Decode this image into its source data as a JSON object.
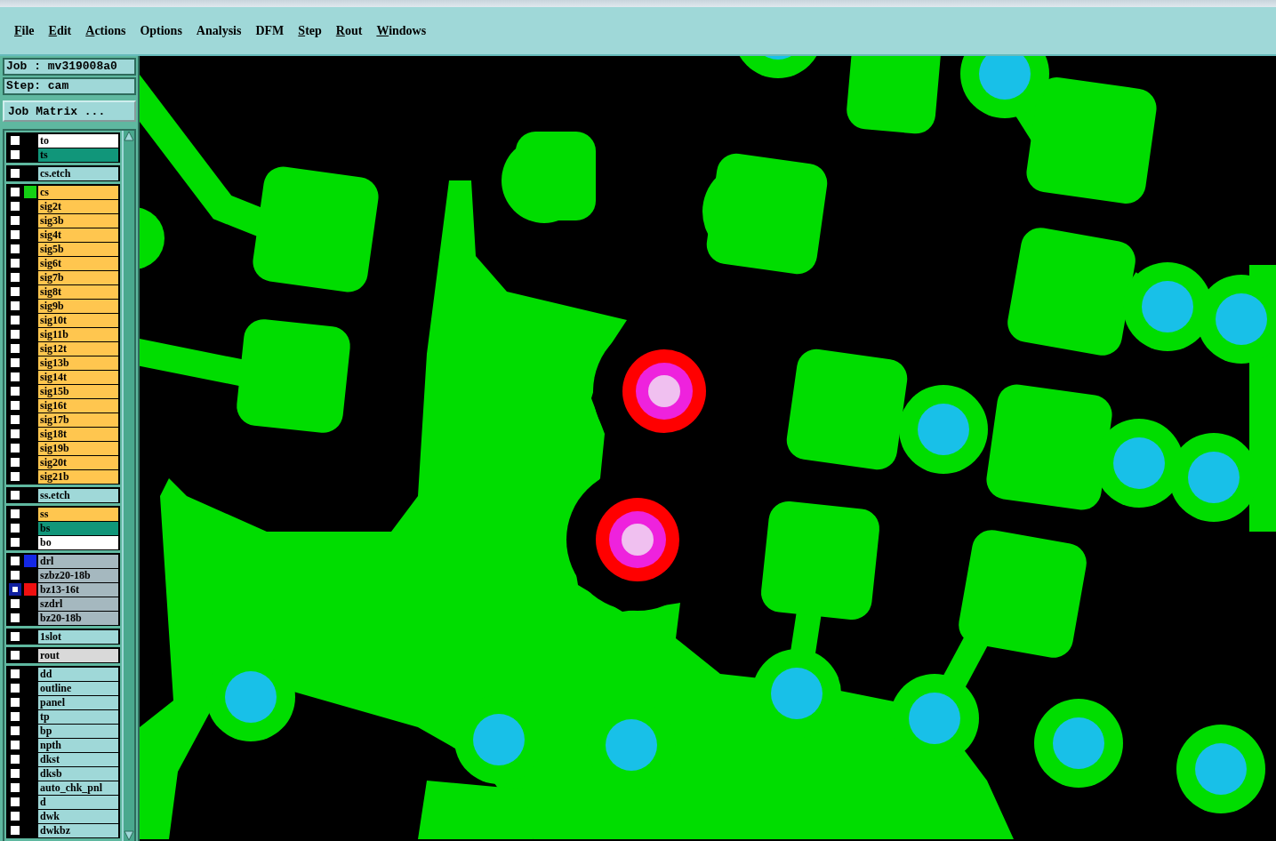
{
  "menu": [
    {
      "label": "File",
      "mnemonic": true
    },
    {
      "label": "Edit",
      "mnemonic": true
    },
    {
      "label": "Actions",
      "mnemonic": true
    },
    {
      "label": "Options",
      "mnemonic": false
    },
    {
      "label": "Analysis",
      "mnemonic": false
    },
    {
      "label": "DFM",
      "mnemonic": false
    },
    {
      "label": "Step",
      "mnemonic": true
    },
    {
      "label": "Rout",
      "mnemonic": true
    },
    {
      "label": "Windows",
      "mnemonic": true
    }
  ],
  "job": "Job : mv319008a0",
  "step": "Step: cam",
  "matrix_button": "Job Matrix ...",
  "layer_groups": [
    {
      "layers": [
        {
          "name": "to",
          "color": "#ffffff",
          "selected": false
        },
        {
          "name": "ts",
          "color": "#11967a",
          "selected": false
        }
      ]
    },
    {
      "layers": [
        {
          "name": "cs.etch",
          "color": "#9fd8d8",
          "selected": false
        }
      ]
    },
    {
      "layers": [
        {
          "name": "cs",
          "color": "#ffc64f",
          "swatch": {
            "color": "#14d014"
          },
          "selected": false
        },
        {
          "name": "sig2t",
          "color": "#ffc64f",
          "selected": false
        },
        {
          "name": "sig3b",
          "color": "#ffc64f",
          "selected": false
        },
        {
          "name": "sig4t",
          "color": "#ffc64f",
          "selected": false
        },
        {
          "name": "sig5b",
          "color": "#ffc64f",
          "selected": false
        },
        {
          "name": "sig6t",
          "color": "#ffc64f",
          "selected": false
        },
        {
          "name": "sig7b",
          "color": "#ffc64f",
          "selected": false
        },
        {
          "name": "sig8t",
          "color": "#ffc64f",
          "selected": false
        },
        {
          "name": "sig9b",
          "color": "#ffc64f",
          "selected": false
        },
        {
          "name": "sig10t",
          "color": "#ffc64f",
          "selected": false
        },
        {
          "name": "sig11b",
          "color": "#ffc64f",
          "selected": false
        },
        {
          "name": "sig12t",
          "color": "#ffc64f",
          "selected": false
        },
        {
          "name": "sig13b",
          "color": "#ffc64f",
          "selected": false
        },
        {
          "name": "sig14t",
          "color": "#ffc64f",
          "selected": false
        },
        {
          "name": "sig15b",
          "color": "#ffc64f",
          "selected": false
        },
        {
          "name": "sig16t",
          "color": "#ffc64f",
          "selected": false
        },
        {
          "name": "sig17b",
          "color": "#ffc64f",
          "selected": false
        },
        {
          "name": "sig18t",
          "color": "#ffc64f",
          "selected": false
        },
        {
          "name": "sig19b",
          "color": "#ffc64f",
          "selected": false
        },
        {
          "name": "sig20t",
          "color": "#ffc64f",
          "selected": false
        },
        {
          "name": "sig21b",
          "color": "#ffc64f",
          "selected": false
        }
      ]
    },
    {
      "layers": [
        {
          "name": "ss.etch",
          "color": "#9fd8d8",
          "selected": false
        }
      ]
    },
    {
      "layers": [
        {
          "name": "ss",
          "color": "#ffc64f",
          "selected": false
        },
        {
          "name": "bs",
          "color": "#11967a",
          "selected": false
        },
        {
          "name": "bo",
          "color": "#ffffff",
          "selected": false
        }
      ]
    },
    {
      "layers": [
        {
          "name": "drl",
          "color": "#a5b8bf",
          "swatch": {
            "color": "#1428e6"
          },
          "selected": false
        },
        {
          "name": "szbz20-18b",
          "color": "#a5b8bf",
          "selected": false
        },
        {
          "name": "bz13-16t",
          "color": "#a5b8bf",
          "swatch": {
            "color": "#f01010"
          },
          "selected": true
        },
        {
          "name": "szdrl",
          "color": "#a5b8bf",
          "selected": false
        },
        {
          "name": "bz20-18b",
          "color": "#a5b8bf",
          "selected": false
        }
      ]
    },
    {
      "layers": [
        {
          "name": "1slot",
          "color": "#9fd8d8",
          "selected": false
        }
      ]
    },
    {
      "layers": [
        {
          "name": "rout",
          "color": "#d9d9d9",
          "selected": false
        }
      ]
    },
    {
      "layers": [
        {
          "name": "dd",
          "color": "#9fd8d8",
          "selected": false
        },
        {
          "name": "outline",
          "color": "#9fd8d8",
          "selected": false
        },
        {
          "name": "panel",
          "color": "#9fd8d8",
          "selected": false
        },
        {
          "name": "tp",
          "color": "#9fd8d8",
          "selected": false
        },
        {
          "name": "bp",
          "color": "#9fd8d8",
          "selected": false
        },
        {
          "name": "npth",
          "color": "#9fd8d8",
          "selected": false
        },
        {
          "name": "dkst",
          "color": "#9fd8d8",
          "selected": false
        },
        {
          "name": "dksb",
          "color": "#9fd8d8",
          "selected": false
        },
        {
          "name": "auto_chk_pnl",
          "color": "#9fd8d8",
          "selected": false
        },
        {
          "name": "d",
          "color": "#9fd8d8",
          "selected": false
        },
        {
          "name": "dwk",
          "color": "#9fd8d8",
          "selected": false
        },
        {
          "name": "dwkbz",
          "color": "#9fd8d8",
          "selected": false
        }
      ]
    }
  ]
}
